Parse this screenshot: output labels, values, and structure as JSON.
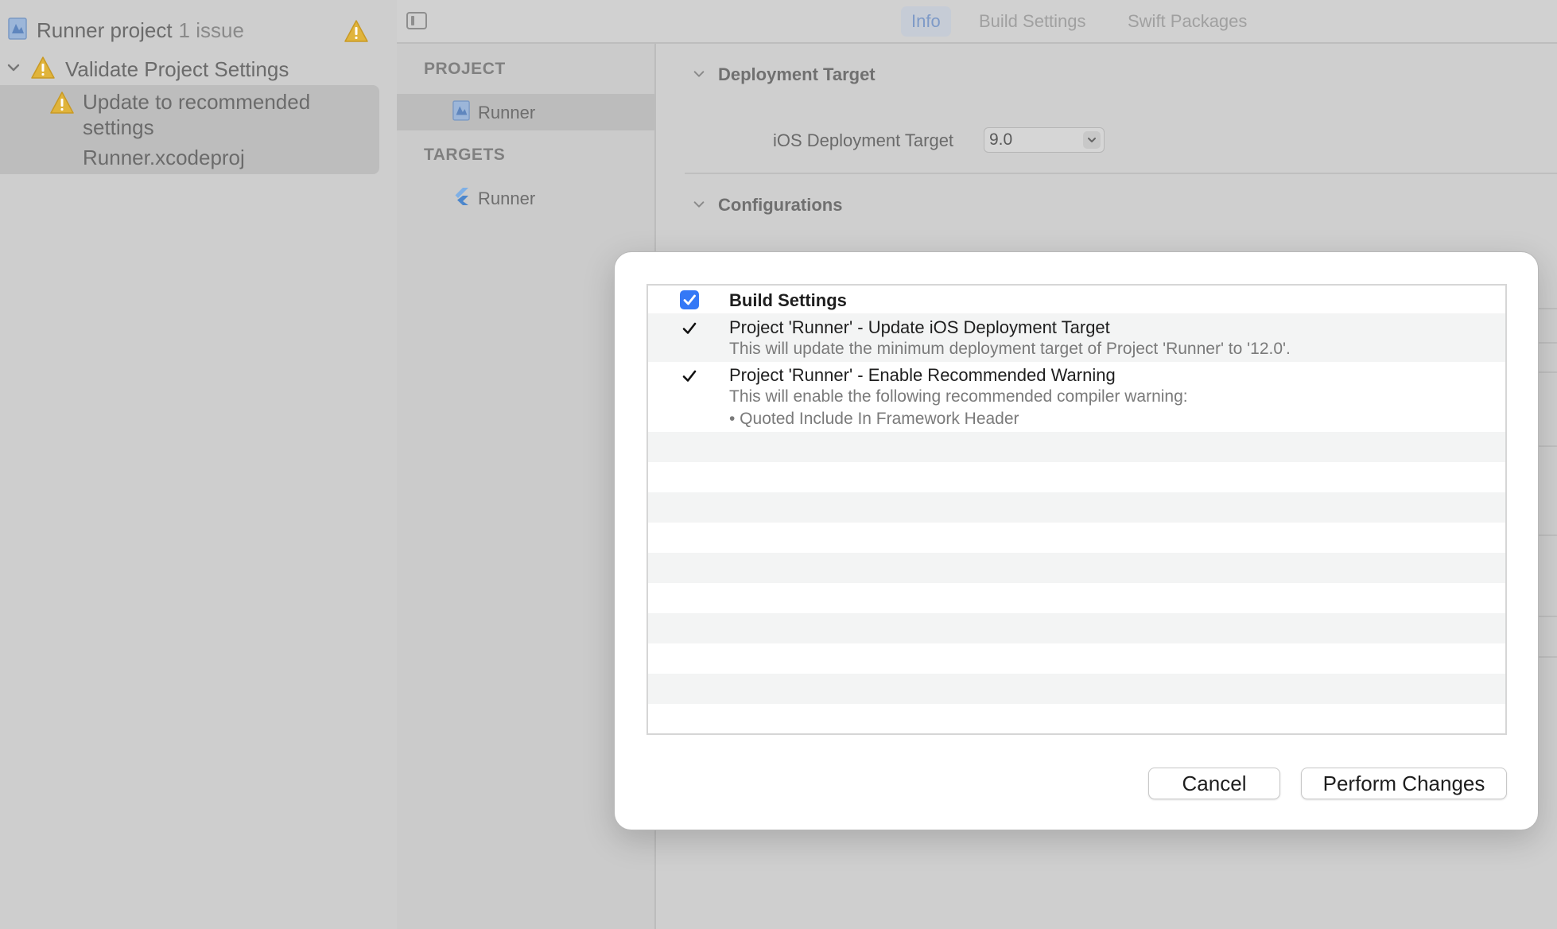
{
  "navigator": {
    "project_name": "Runner project",
    "issue_count": "1 issue",
    "group_title": "Validate Project Settings",
    "issue_title": "Update to recommended settings",
    "issue_title_line1": "Update to recommended",
    "issue_title_line2": "settings",
    "issue_file": "Runner.xcodeproj"
  },
  "target_list": {
    "project_header": "PROJECT",
    "project_item": "Runner",
    "targets_header": "TARGETS",
    "target_item": "Runner"
  },
  "tabs": [
    {
      "label": "Info",
      "active": true
    },
    {
      "label": "Build Settings",
      "active": false
    },
    {
      "label": "Swift Packages",
      "active": false
    }
  ],
  "editor": {
    "deployment_section": "Deployment Target",
    "ios_target_label": "iOS Deployment Target",
    "ios_target_value": "9.0",
    "configurations_section": "Configurations"
  },
  "sheet": {
    "rows": [
      {
        "title": "Build Settings",
        "checked": true
      },
      {
        "title": "Project 'Runner' - Update iOS Deployment Target",
        "desc": "This will update the minimum deployment target of Project 'Runner' to '12.0'.",
        "checked": true
      },
      {
        "title": "Project 'Runner' - Enable Recommended Warning",
        "desc": "This will enable the following recommended compiler warning:",
        "desc2": "• Quoted Include In Framework Header",
        "checked": true
      }
    ],
    "cancel_label": "Cancel",
    "perform_label": "Perform Changes"
  },
  "colors": {
    "accent": "#3478f6",
    "warning": "#e0b43c"
  },
  "icons": {
    "project": "xcode-project-icon",
    "warning": "warning-triangle-icon",
    "target": "flutter-icon"
  }
}
